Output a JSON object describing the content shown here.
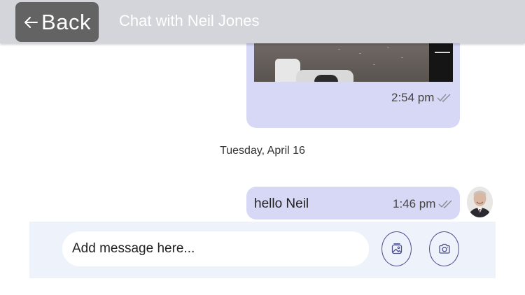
{
  "header": {
    "back_label": "Back",
    "title": "Chat with Neil Jones"
  },
  "messages": [
    {
      "type": "image",
      "time": "2:54 pm",
      "read": true
    },
    {
      "type": "date_separator",
      "text": "Tuesday, April 16"
    },
    {
      "type": "text",
      "text": "hello Neil",
      "time": "1:46 pm",
      "read": true
    }
  ],
  "composer": {
    "placeholder": "Add message here...",
    "value": "",
    "gallery_icon": "gallery-icon",
    "camera_icon": "camera-icon"
  },
  "colors": {
    "header_bg": "#d4d5da",
    "back_button_bg": "#636363",
    "bubble_bg": "#d7d7f6",
    "composer_bg": "#eef2fb",
    "icon_color": "#4d4f8c"
  }
}
